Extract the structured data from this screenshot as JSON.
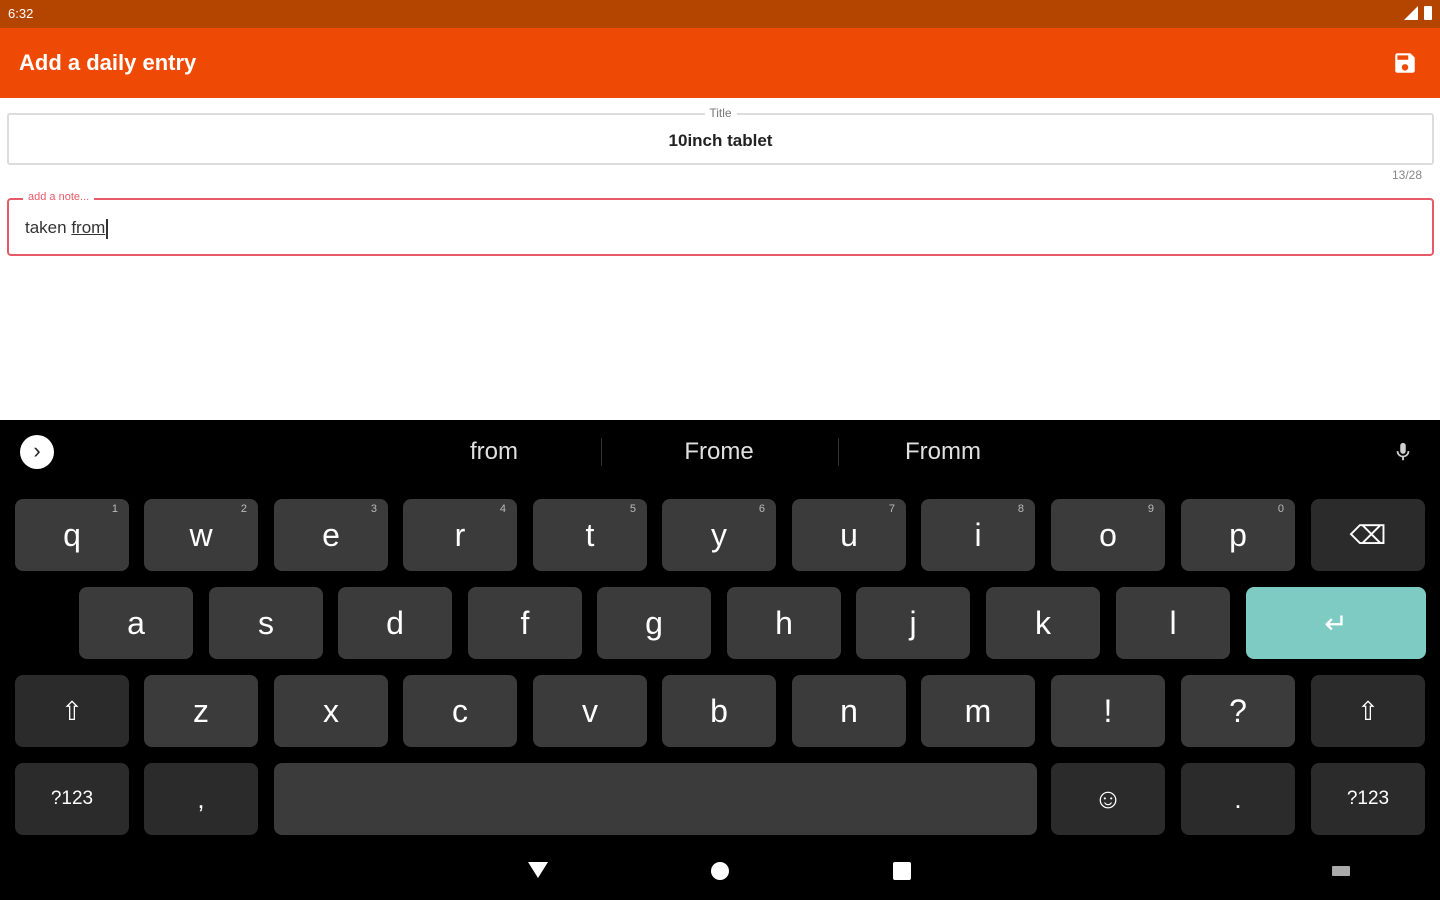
{
  "status_bar": {
    "time": "6:32"
  },
  "app_bar": {
    "title": "Add a daily entry",
    "save_icon": "save-icon",
    "bg_color": "#EE4A05"
  },
  "form": {
    "title_field": {
      "label": "Title",
      "value": "10inch tablet",
      "counter": "13/28"
    },
    "note_field": {
      "label": "add a note...",
      "value_prefix": "taken ",
      "value_composing": "from",
      "accent_color": "#E85A68"
    }
  },
  "keyboard": {
    "suggestions": [
      "from",
      "Frome",
      "Fromm"
    ],
    "row1": [
      {
        "label": "q",
        "hint": "1"
      },
      {
        "label": "w",
        "hint": "2"
      },
      {
        "label": "e",
        "hint": "3"
      },
      {
        "label": "r",
        "hint": "4"
      },
      {
        "label": "t",
        "hint": "5"
      },
      {
        "label": "y",
        "hint": "6"
      },
      {
        "label": "u",
        "hint": "7"
      },
      {
        "label": "i",
        "hint": "8"
      },
      {
        "label": "o",
        "hint": "9"
      },
      {
        "label": "p",
        "hint": "0"
      }
    ],
    "row2": [
      "a",
      "s",
      "d",
      "f",
      "g",
      "h",
      "j",
      "k",
      "l"
    ],
    "row3": [
      "z",
      "x",
      "c",
      "v",
      "b",
      "n",
      "m",
      "!",
      "?"
    ],
    "symbols_label": "?123",
    "comma_label": ",",
    "period_label": ".",
    "enter_icon": "return-arrow-icon",
    "enter_color": "#7ECBC4",
    "icons": {
      "shift": "⇧",
      "backspace": "⌫",
      "enter": "↵",
      "emoji": "☺",
      "expand": "›"
    }
  }
}
